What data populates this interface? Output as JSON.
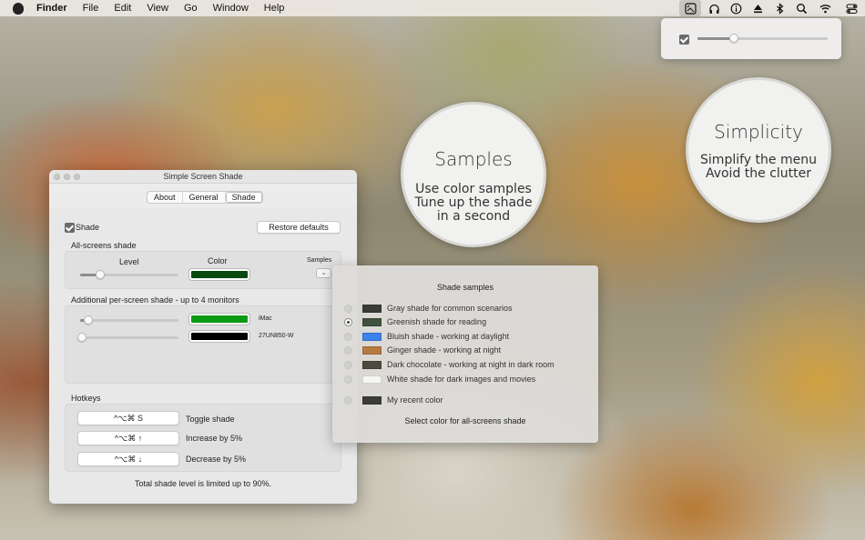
{
  "menubar": {
    "items": [
      "Finder",
      "File",
      "Edit",
      "View",
      "Go",
      "Window",
      "Help"
    ],
    "status_icons": [
      "shade-app-icon",
      "headphones-icon",
      "info-icon",
      "eject-icon",
      "bluetooth-icon",
      "search-icon",
      "wifi-icon",
      "control-center-icon"
    ]
  },
  "popover": {
    "checked": true,
    "level": 0.28
  },
  "bubbles": {
    "samples": {
      "title": "Samples",
      "line1": "Use color samples",
      "line2": "Tune up the shade",
      "line3": "in a second"
    },
    "simplicity": {
      "title": "Simplicity",
      "line1": "Simplify the menu",
      "line2": "Avoid the clutter"
    }
  },
  "window": {
    "title": "Simple Screen Shade",
    "tabs": [
      "About",
      "General",
      "Shade"
    ],
    "selected_tab": "Shade",
    "shade_checkbox": "Shade",
    "restore_button": "Restore defaults",
    "all_screens": {
      "heading": "All-screens shade",
      "level_label": "Level",
      "color_label": "Color",
      "samples_label": "Samples",
      "color": "#0a4a12",
      "level": 0.2
    },
    "per_screen": {
      "heading": "Additional per-screen shade - up to 4 monitors",
      "screens": [
        {
          "name": "iMac",
          "color": "#0c9a14",
          "level": 0.08
        },
        {
          "name": "27UN850-W",
          "color": "#000000",
          "level": 0.02
        }
      ]
    },
    "hotkeys": {
      "heading": "Hotkeys",
      "items": [
        {
          "keys": "^⌥⌘ S",
          "label": "Toggle shade"
        },
        {
          "keys": "^⌥⌘ ↑",
          "label": "Increase by 5%"
        },
        {
          "keys": "^⌥⌘ ↓",
          "label": "Decrease by 5%"
        }
      ]
    },
    "footer": "Total shade level is limited up to 90%."
  },
  "samples_panel": {
    "title": "Shade samples",
    "items": [
      {
        "label": "Gray shade for common scenarios",
        "color": "#3a3c38",
        "selected": false
      },
      {
        "label": "Greenish shade for reading",
        "color": "#3f5240",
        "selected": true
      },
      {
        "label": "Bluish shade - working at daylight",
        "color": "#3b82ec",
        "selected": false
      },
      {
        "label": "Ginger shade - working at night",
        "color": "#b87a42",
        "selected": false
      },
      {
        "label": "Dark chocolate - working at night in dark room",
        "color": "#4a4a3e",
        "selected": false
      },
      {
        "label": "White shade for dark images and movies",
        "color": "#f6f6f4",
        "selected": false
      }
    ],
    "recent": {
      "label": "My recent color",
      "color": "#3c3c3a"
    },
    "footer": "Select color for all-screens shade"
  }
}
